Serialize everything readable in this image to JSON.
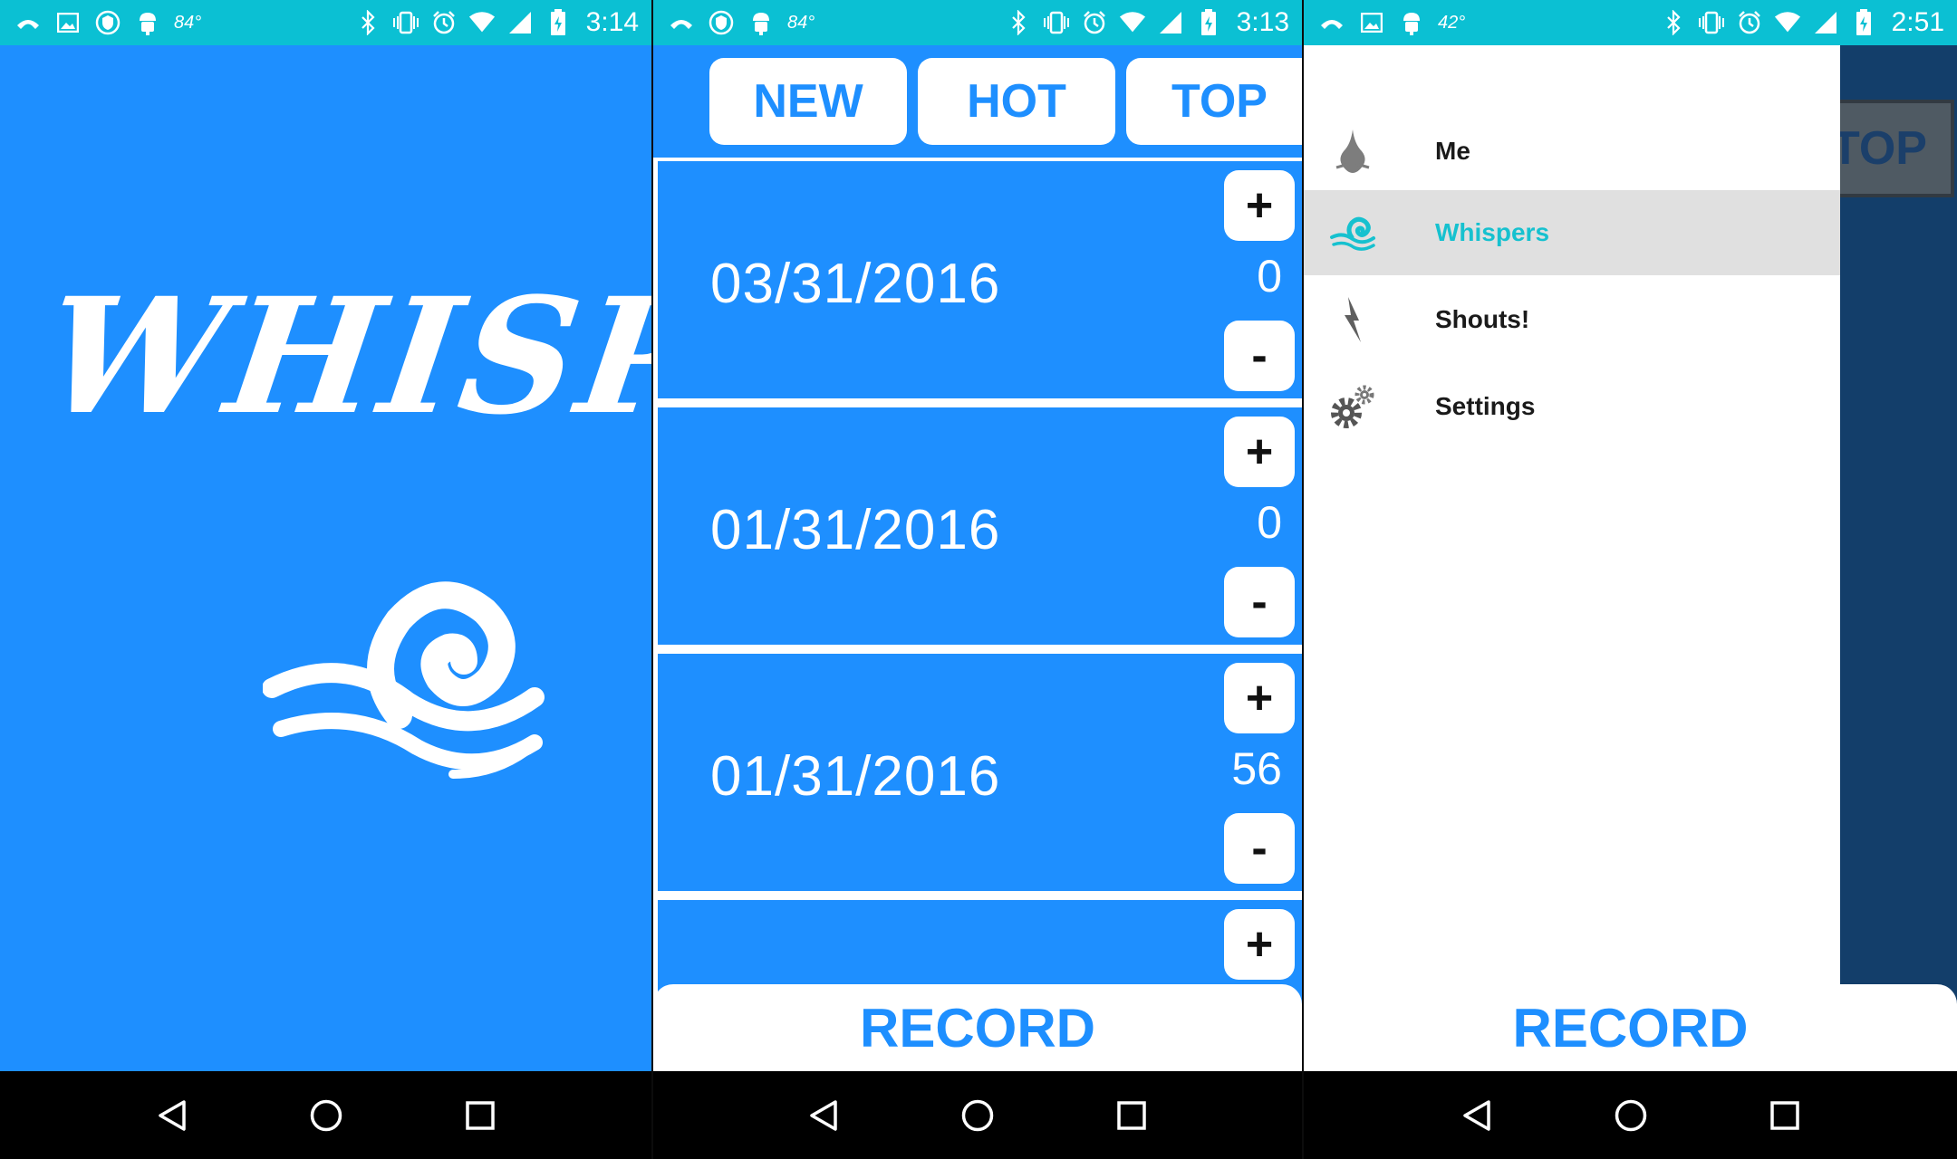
{
  "colors": {
    "primary_blue": "#1e8fff",
    "status_bar": "#0bc0d3",
    "accent_teal": "#16c1cf",
    "dim_overlay": "#133e6a"
  },
  "screens": [
    {
      "statusbar": {
        "temperature": "84°",
        "time": "3:14"
      },
      "splash": {
        "logo_text": "WHISP"
      }
    },
    {
      "statusbar": {
        "temperature": "84°",
        "time": "3:13"
      },
      "tabs": [
        {
          "label": "NEW"
        },
        {
          "label": "HOT"
        },
        {
          "label": "TOP"
        }
      ],
      "whispers": [
        {
          "date": "03/31/2016",
          "votes": "0",
          "upvote_label": "+",
          "downvote_label": "-"
        },
        {
          "date": "01/31/2016",
          "votes": "0",
          "upvote_label": "+",
          "downvote_label": "-"
        },
        {
          "date": "01/31/2016",
          "votes": "56",
          "upvote_label": "+",
          "downvote_label": "-"
        },
        {
          "upvote_label": "+"
        }
      ],
      "record_label": "RECORD"
    },
    {
      "statusbar": {
        "temperature": "42°",
        "time": "2:51"
      },
      "behind_tab_label": "TOP",
      "menu": [
        {
          "label": "Me",
          "icon": "flame-icon"
        },
        {
          "label": "Whispers",
          "icon": "wind-swirl-icon",
          "selected": true
        },
        {
          "label": "Shouts!",
          "icon": "lightning-icon"
        },
        {
          "label": "Settings",
          "icon": "gears-icon"
        }
      ],
      "record_label": "RECORD"
    }
  ]
}
